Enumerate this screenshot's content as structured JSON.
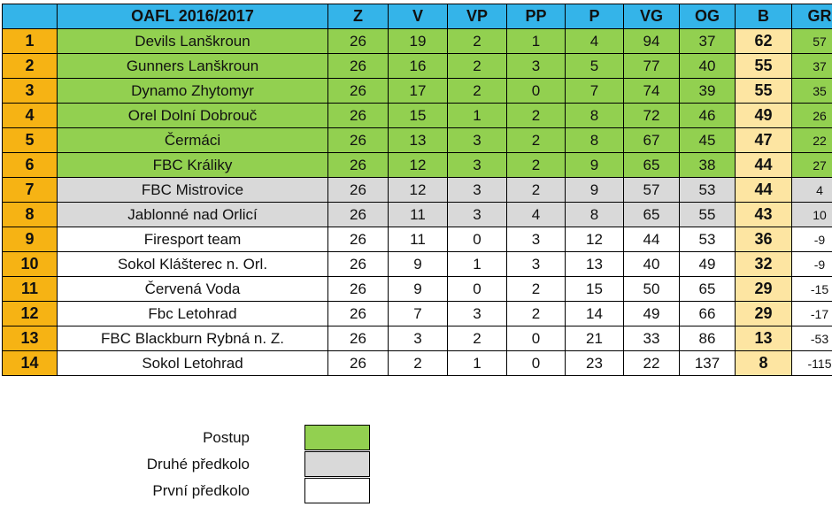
{
  "table": {
    "title": "OAFL 2016/2017",
    "columns": [
      "Z",
      "V",
      "VP",
      "PP",
      "P",
      "VG",
      "OG",
      "B",
      "GR"
    ],
    "rows": [
      {
        "rank": "1",
        "team": "Devils Lanškroun",
        "z": "26",
        "v": "19",
        "vp": "2",
        "pp": "1",
        "p": "4",
        "vg": "94",
        "og": "37",
        "b": "62",
        "gr": "57",
        "zone": "postup"
      },
      {
        "rank": "2",
        "team": "Gunners Lanškroun",
        "z": "26",
        "v": "16",
        "vp": "2",
        "pp": "3",
        "p": "5",
        "vg": "77",
        "og": "40",
        "b": "55",
        "gr": "37",
        "zone": "postup"
      },
      {
        "rank": "3",
        "team": "Dynamo Zhytomyr",
        "z": "26",
        "v": "17",
        "vp": "2",
        "pp": "0",
        "p": "7",
        "vg": "74",
        "og": "39",
        "b": "55",
        "gr": "35",
        "zone": "postup"
      },
      {
        "rank": "4",
        "team": "Orel Dolní Dobrouč",
        "z": "26",
        "v": "15",
        "vp": "1",
        "pp": "2",
        "p": "8",
        "vg": "72",
        "og": "46",
        "b": "49",
        "gr": "26",
        "zone": "postup"
      },
      {
        "rank": "5",
        "team": "Čermáci",
        "z": "26",
        "v": "13",
        "vp": "3",
        "pp": "2",
        "p": "8",
        "vg": "67",
        "og": "45",
        "b": "47",
        "gr": "22",
        "zone": "postup"
      },
      {
        "rank": "6",
        "team": "FBC Králiky",
        "z": "26",
        "v": "12",
        "vp": "3",
        "pp": "2",
        "p": "9",
        "vg": "65",
        "og": "38",
        "b": "44",
        "gr": "27",
        "zone": "postup"
      },
      {
        "rank": "7",
        "team": "FBC Mistrovice",
        "z": "26",
        "v": "12",
        "vp": "3",
        "pp": "2",
        "p": "9",
        "vg": "57",
        "og": "53",
        "b": "44",
        "gr": "4",
        "zone": "druhe"
      },
      {
        "rank": "8",
        "team": "Jablonné nad Orlicí",
        "z": "26",
        "v": "11",
        "vp": "3",
        "pp": "4",
        "p": "8",
        "vg": "65",
        "og": "55",
        "b": "43",
        "gr": "10",
        "zone": "druhe"
      },
      {
        "rank": "9",
        "team": "Firesport team",
        "z": "26",
        "v": "11",
        "vp": "0",
        "pp": "3",
        "p": "12",
        "vg": "44",
        "og": "53",
        "b": "36",
        "gr": "-9",
        "zone": "prvni"
      },
      {
        "rank": "10",
        "team": "Sokol Klášterec n. Orl.",
        "z": "26",
        "v": "9",
        "vp": "1",
        "pp": "3",
        "p": "13",
        "vg": "40",
        "og": "49",
        "b": "32",
        "gr": "-9",
        "zone": "prvni"
      },
      {
        "rank": "11",
        "team": "Červená Voda",
        "z": "26",
        "v": "9",
        "vp": "0",
        "pp": "2",
        "p": "15",
        "vg": "50",
        "og": "65",
        "b": "29",
        "gr": "-15",
        "zone": "prvni"
      },
      {
        "rank": "12",
        "team": "Fbc Letohrad",
        "z": "26",
        "v": "7",
        "vp": "3",
        "pp": "2",
        "p": "14",
        "vg": "49",
        "og": "66",
        "b": "29",
        "gr": "-17",
        "zone": "prvni"
      },
      {
        "rank": "13",
        "team": "FBC Blackburn Rybná n. Z.",
        "z": "26",
        "v": "3",
        "vp": "2",
        "pp": "0",
        "p": "21",
        "vg": "33",
        "og": "86",
        "b": "13",
        "gr": "-53",
        "zone": "prvni"
      },
      {
        "rank": "14",
        "team": "Sokol Letohrad",
        "z": "26",
        "v": "2",
        "vp": "1",
        "pp": "0",
        "p": "23",
        "vg": "22",
        "og": "137",
        "b": "8",
        "gr": "-115",
        "zone": "prvni"
      }
    ]
  },
  "legend": {
    "items": [
      {
        "label": "Postup",
        "color": "#92d050"
      },
      {
        "label": "Druhé předkolo",
        "color": "#d9d9d9"
      },
      {
        "label": "První předkolo",
        "color": "#ffffff"
      }
    ]
  },
  "colors": {
    "header": "#34b4e9",
    "rank": "#f6b314",
    "points": "#fde5a2"
  }
}
